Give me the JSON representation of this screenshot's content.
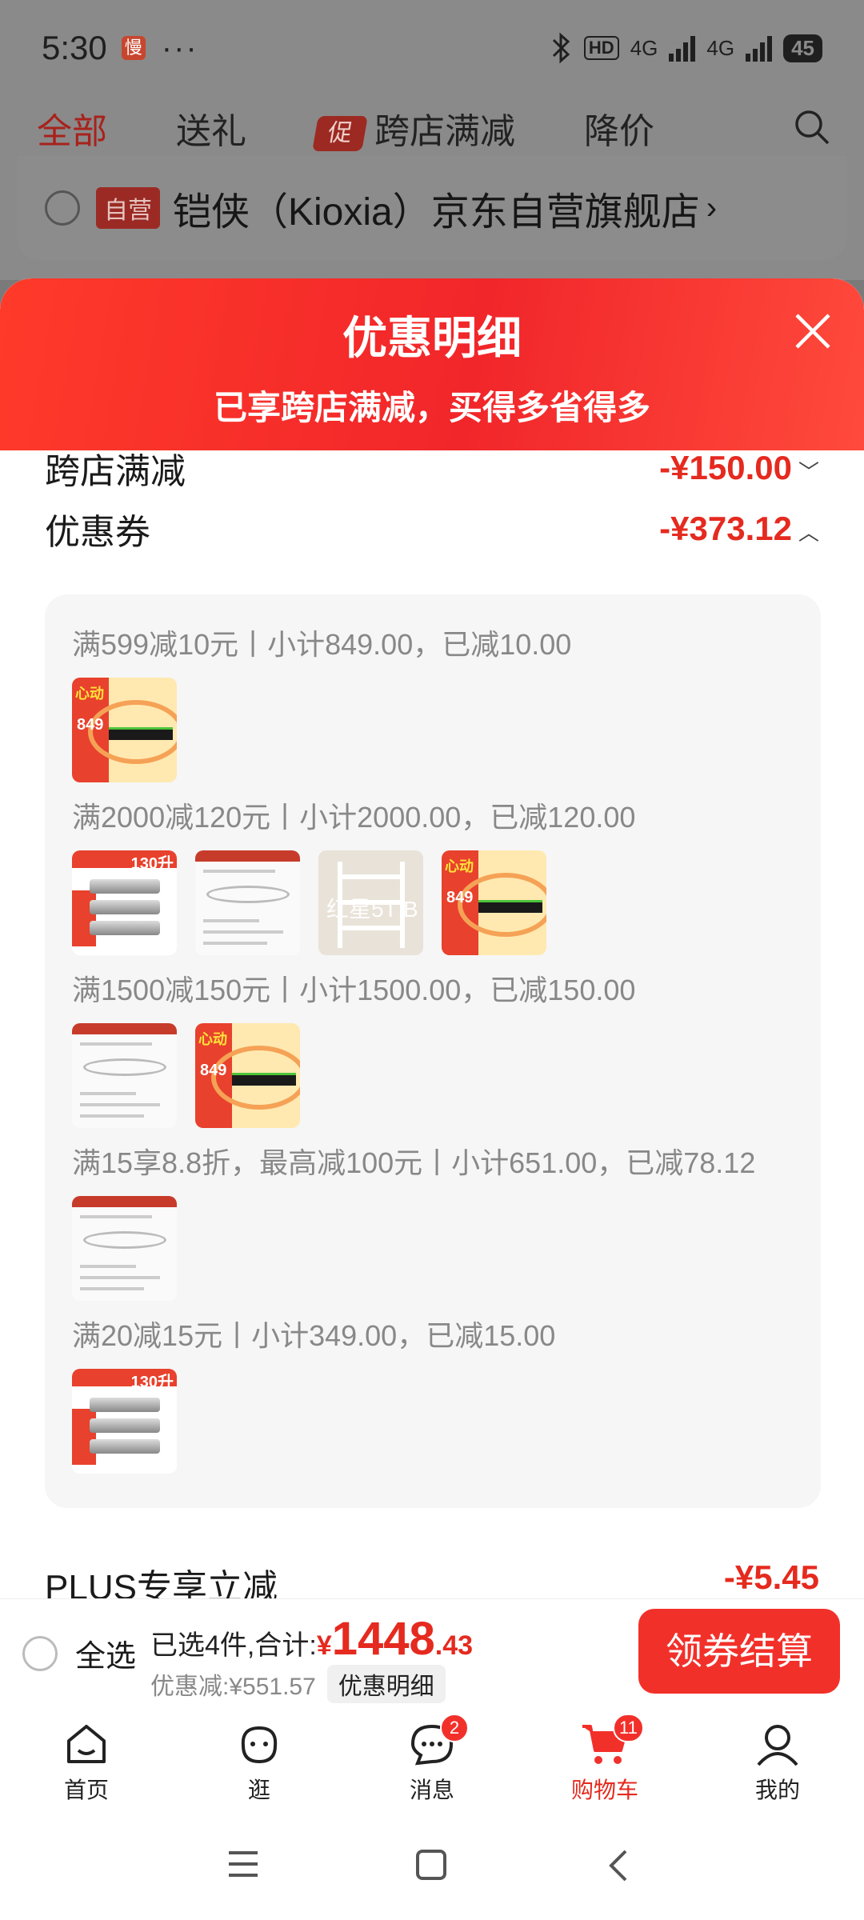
{
  "status_bar": {
    "time": "5:30",
    "app_badge": "慢",
    "dots": "···",
    "hd": "HD",
    "net1": "4G",
    "net2": "4G",
    "battery": "45"
  },
  "top_tabs": [
    {
      "label": "全部",
      "active": true
    },
    {
      "label": "送礼"
    },
    {
      "label": "跨店满减",
      "badge": "促"
    },
    {
      "label": "降价"
    }
  ],
  "store": {
    "badge": "自营",
    "name": "铠侠（Kioxia）京东自营旗舰店",
    "chevron": "›"
  },
  "sheet": {
    "title": "优惠明细",
    "subtitle": "已享跨店满减，买得多省得多",
    "rows": {
      "cross_store": {
        "label": "跨店满减",
        "amount": "-¥150.00",
        "caret": "﹀"
      },
      "coupon": {
        "label": "优惠券",
        "amount": "-¥373.12",
        "caret": "︿"
      }
    },
    "coupon_groups": [
      {
        "label": "满599减10元丨小计849.00，已减10.00",
        "items": [
          "ssd"
        ]
      },
      {
        "label": "满2000减120元丨小计2000.00，已减120.00",
        "items": [
          "pot",
          "lamp",
          "shelf",
          "ssd"
        ]
      },
      {
        "label": "满1500减150元丨小计1500.00，已减150.00",
        "items": [
          "lamp",
          "ssd"
        ]
      },
      {
        "label": "满15享8.8折，最高减100元丨小计651.00，已减78.12",
        "items": [
          "lamp"
        ]
      },
      {
        "label": "满20减15元丨小计349.00，已减15.00",
        "items": [
          "pot"
        ]
      }
    ],
    "thumb_text": {
      "ssd_tag": "心动",
      "ssd_price": "849",
      "pot_tag": "130升",
      "shelf_watermark": "红星5T B"
    },
    "plus": {
      "label": "PLUS专享立减",
      "amount": "-¥5.45"
    }
  },
  "checkout": {
    "select_all": "全选",
    "summary_prefix": "已选4件,合计:",
    "currency": "¥",
    "total_int": "1448",
    "total_dec": ".43",
    "discount": "优惠减:¥551.57",
    "detail_btn": "优惠明细",
    "pay_btn": "领券结算"
  },
  "tabbar": [
    {
      "label": "首页",
      "icon": "home-icon"
    },
    {
      "label": "逛",
      "icon": "face-icon"
    },
    {
      "label": "消息",
      "icon": "message-icon",
      "badge": "2"
    },
    {
      "label": "购物车",
      "icon": "cart-icon",
      "badge": "11",
      "active": true
    },
    {
      "label": "我的",
      "icon": "user-icon"
    }
  ],
  "colors": {
    "accent": "#e52a1f",
    "header_red": "#f1262a"
  }
}
